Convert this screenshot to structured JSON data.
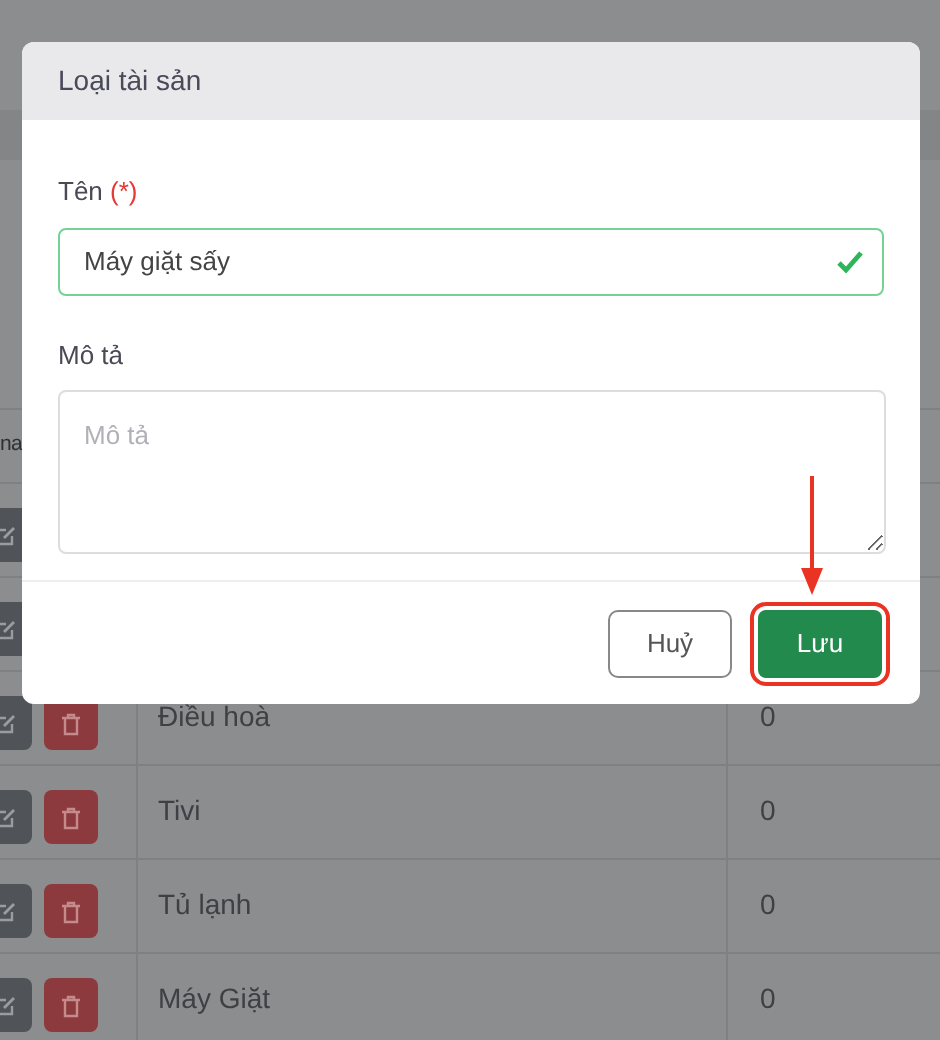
{
  "background_table": {
    "header_fragment": "na",
    "rows": [
      {
        "name": "",
        "value": ""
      },
      {
        "name": "",
        "value": ""
      },
      {
        "name": "Điều hoà",
        "value": "0"
      },
      {
        "name": "Tivi",
        "value": "0"
      },
      {
        "name": "Tủ lạnh",
        "value": "0"
      },
      {
        "name": "Máy Giặt",
        "value": "0"
      }
    ]
  },
  "modal": {
    "title": "Loại tài sản",
    "fields": [
      {
        "kind": "input",
        "label": "Tên",
        "required_mark": "(*)",
        "value": "Máy giặt sấy",
        "valid": true
      },
      {
        "kind": "textarea",
        "label": "Mô tả",
        "placeholder": "Mô tả"
      }
    ],
    "buttons": [
      {
        "label": "Huỷ",
        "kind": "secondary",
        "highlighted": false
      },
      {
        "label": "Lưu",
        "kind": "primary",
        "highlighted": true
      }
    ]
  }
}
